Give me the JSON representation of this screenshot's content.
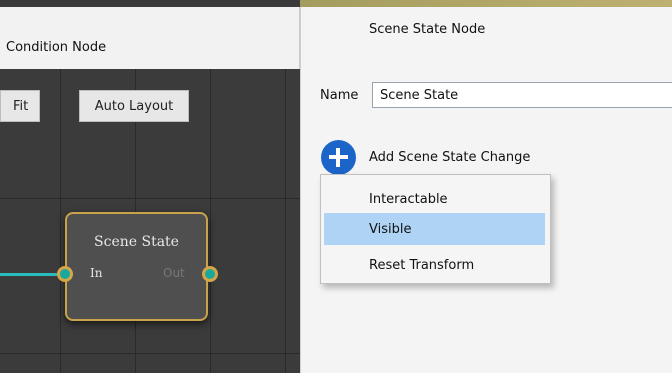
{
  "left_panel": {
    "title": "Condition Node",
    "toolbar": {
      "fit_label": "Fit",
      "auto_layout_label": "Auto Layout"
    },
    "node": {
      "title": "Scene State",
      "in_label": "In",
      "out_label": "Out"
    }
  },
  "right_panel": {
    "title": "Scene State Node",
    "name_label": "Name",
    "name_value": "Scene State",
    "add_icon": "plus-circle-icon",
    "add_label": "Add Scene State Change",
    "menu": {
      "items": [
        {
          "label": "Interactable"
        },
        {
          "label": "Visible",
          "highlighted": true
        },
        {
          "label": "Reset Transform"
        }
      ]
    }
  },
  "colors": {
    "accent": "#1b64c8",
    "menu_highlight": "#aed3f5",
    "node_border": "#c9a24b",
    "connection": "#28bcbc",
    "graph_background": "#3b3b3b"
  }
}
